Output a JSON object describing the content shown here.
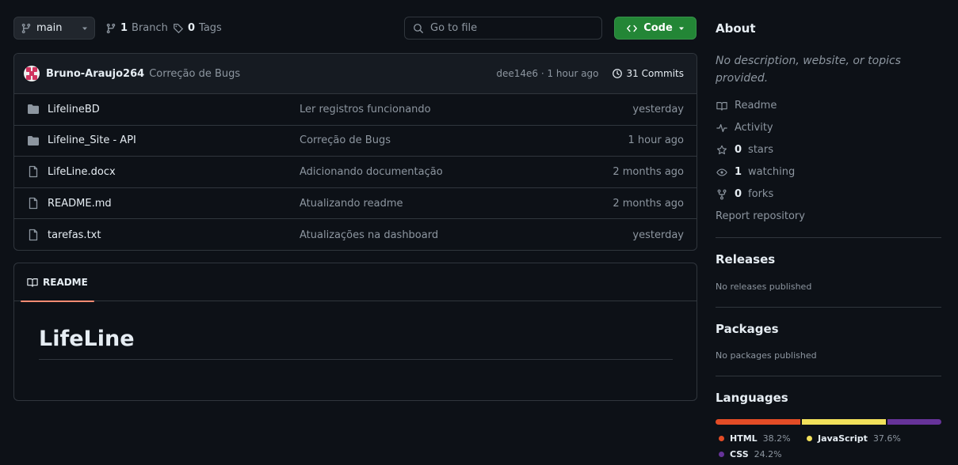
{
  "toolbar": {
    "branch": "main",
    "branch_count": "1",
    "branch_word": "Branch",
    "tag_count": "0",
    "tag_word": "Tags",
    "goto_placeholder": "Go to file",
    "code_label": "Code"
  },
  "commit": {
    "author": "Bruno-Araujo264",
    "message": "Correção de Bugs",
    "hash_time": "dee14e6 · 1 hour ago",
    "commits_label": "31 Commits"
  },
  "files": [
    {
      "name": "LifelineBD",
      "type": "folder",
      "message": "Ler registros funcionando",
      "date": "yesterday"
    },
    {
      "name": "Lifeline_Site - API",
      "type": "folder",
      "message": "Correção de Bugs",
      "date": "1 hour ago"
    },
    {
      "name": "LifeLine.docx",
      "type": "file",
      "message": "Adicionando documentação",
      "date": "2 months ago"
    },
    {
      "name": "README.md",
      "type": "file",
      "message": "Atualizando readme",
      "date": "2 months ago"
    },
    {
      "name": "tarefas.txt",
      "type": "file",
      "message": "Atualizações na dashboard",
      "date": "yesterday"
    }
  ],
  "readme": {
    "tab_label": "README",
    "heading": "LifeLine"
  },
  "about": {
    "title": "About",
    "description": "No description, website, or topics provided.",
    "readme": "Readme",
    "activity": "Activity",
    "stars_count": "0",
    "stars_word": "stars",
    "watching_count": "1",
    "watching_word": "watching",
    "forks_count": "0",
    "forks_word": "forks",
    "report": "Report repository"
  },
  "releases": {
    "title": "Releases",
    "note": "No releases published"
  },
  "packages": {
    "title": "Packages",
    "note": "No packages published"
  },
  "languages": {
    "title": "Languages",
    "items": [
      {
        "name": "HTML",
        "percent": "38.2%",
        "value": 38.2,
        "color": "#e34c26"
      },
      {
        "name": "JavaScript",
        "percent": "37.6%",
        "value": 37.6,
        "color": "#f1e05a"
      },
      {
        "name": "CSS",
        "percent": "24.2%",
        "value": 24.2,
        "color": "#663399"
      }
    ]
  }
}
